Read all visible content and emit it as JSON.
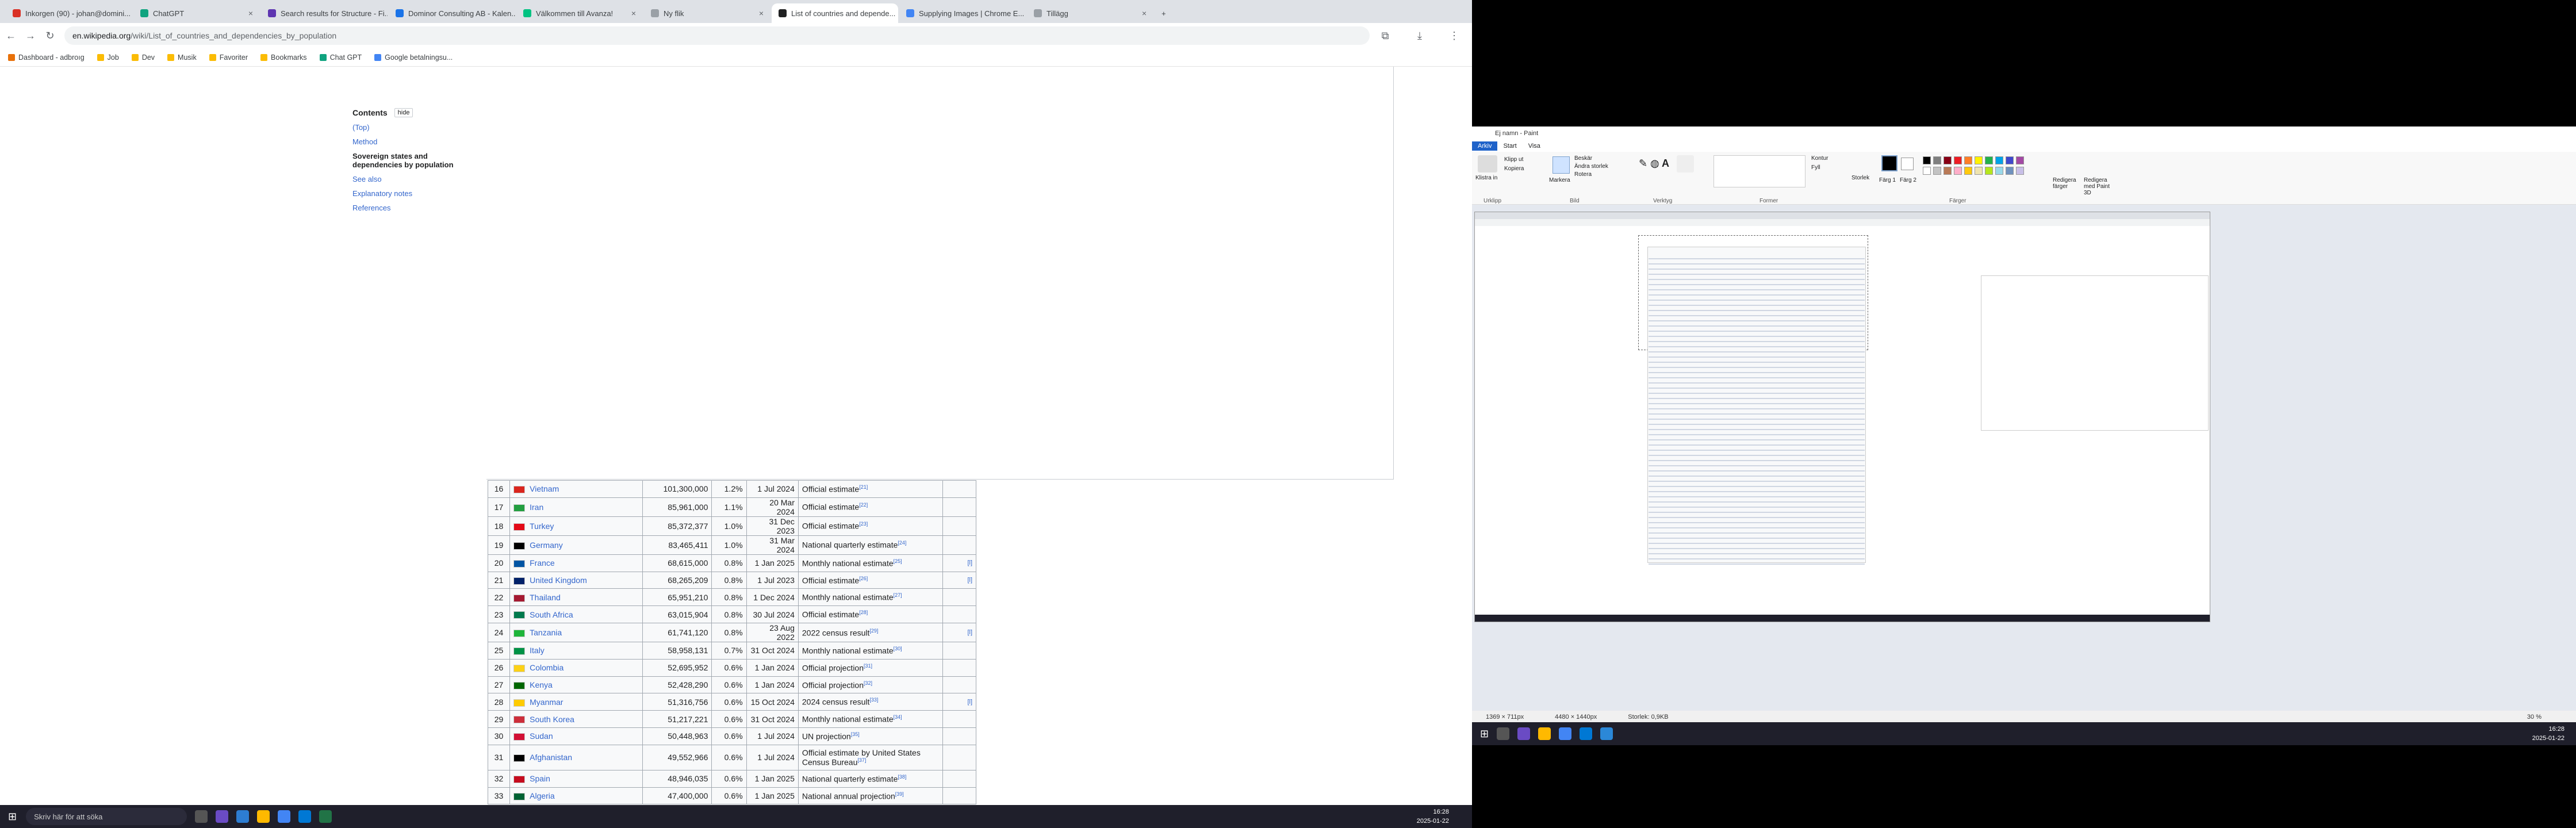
{
  "browser": {
    "tabs": [
      {
        "label": "Inkorgen (90) - johan@domini...",
        "color": "#d93025"
      },
      {
        "label": "ChatGPT",
        "color": "#10a37f"
      },
      {
        "label": "Search results for Structure - Fi...",
        "color": "#5e35b1"
      },
      {
        "label": "Dominor Consulting AB - Kalen...",
        "color": "#1a73e8"
      },
      {
        "label": "Välkommen till Avanza!",
        "color": "#00c281"
      },
      {
        "label": "Ny flik",
        "color": "#9aa0a6"
      },
      {
        "label": "List of countries and depende...",
        "color": "#202122"
      },
      {
        "label": "Supplying Images | Chrome E...",
        "color": "#4285f4"
      },
      {
        "label": "Tillägg",
        "color": "#9aa0a6"
      }
    ],
    "url_host": "en.wikipedia.org",
    "url_path": "/wiki/List_of_countries_and_dependencies_by_population",
    "bookmarks": [
      "Dashboard - adbroıg",
      "Job",
      "Dev",
      "Musik",
      "Favoriter",
      "Bookmarks",
      "Chat GPT",
      "Google betalningsu..."
    ]
  },
  "toc": {
    "title": "Contents",
    "hide_label": "hide",
    "items": [
      "(Top)",
      "Method"
    ],
    "current": "Sovereign states and dependencies by population",
    "items_after": [
      "See also",
      "Explanatory notes",
      "References"
    ]
  },
  "table_rows": [
    {
      "rank": "16",
      "country": "Vietnam",
      "population": "101,300,000",
      "share": "1.2%",
      "date": "1 Jul 2024",
      "source": "Official estimate",
      "ref": "[21]",
      "note": "",
      "flag": "#da251d"
    },
    {
      "rank": "17",
      "country": "Iran",
      "population": "85,961,000",
      "share": "1.1%",
      "date": "20 Mar 2024",
      "source": "Official estimate",
      "ref": "[22]",
      "note": "",
      "flag": "#239f40"
    },
    {
      "rank": "18",
      "country": "Turkey",
      "population": "85,372,377",
      "share": "1.0%",
      "date": "31 Dec 2023",
      "source": "Official estimate",
      "ref": "[23]",
      "note": "",
      "flag": "#e30a17"
    },
    {
      "rank": "19",
      "country": "Germany",
      "population": "83,465,411",
      "share": "1.0%",
      "date": "31 Mar 2024",
      "source": "National quarterly estimate",
      "ref": "[24]",
      "note": "",
      "flag": "#000000"
    },
    {
      "rank": "20",
      "country": "France",
      "population": "68,615,000",
      "share": "0.8%",
      "date": "1 Jan 2025",
      "source": "Monthly national estimate",
      "ref": "[25]",
      "note": "[l]",
      "flag": "#0055a4"
    },
    {
      "rank": "21",
      "country": "United Kingdom",
      "population": "68,265,209",
      "share": "0.8%",
      "date": "1 Jul 2023",
      "source": "Official estimate",
      "ref": "[26]",
      "note": "[l]",
      "flag": "#012169"
    },
    {
      "rank": "22",
      "country": "Thailand",
      "population": "65,951,210",
      "share": "0.8%",
      "date": "1 Dec 2024",
      "source": "Monthly national estimate",
      "ref": "[27]",
      "note": "",
      "flag": "#a51931"
    },
    {
      "rank": "23",
      "country": "South Africa",
      "population": "63,015,904",
      "share": "0.8%",
      "date": "30 Jul 2024",
      "source": "Official estimate",
      "ref": "[28]",
      "note": "",
      "flag": "#007a4d"
    },
    {
      "rank": "24",
      "country": "Tanzania",
      "population": "61,741,120",
      "share": "0.8%",
      "date": "23 Aug 2022",
      "source": "2022 census result",
      "ref": "[29]",
      "note": "[l]",
      "flag": "#1eb53a"
    },
    {
      "rank": "25",
      "country": "Italy",
      "population": "58,958,131",
      "share": "0.7%",
      "date": "31 Oct 2024",
      "source": "Monthly national estimate",
      "ref": "[30]",
      "note": "",
      "flag": "#009246"
    },
    {
      "rank": "26",
      "country": "Colombia",
      "population": "52,695,952",
      "share": "0.6%",
      "date": "1 Jan 2024",
      "source": "Official projection",
      "ref": "[31]",
      "note": "",
      "flag": "#fcd116"
    },
    {
      "rank": "27",
      "country": "Kenya",
      "population": "52,428,290",
      "share": "0.6%",
      "date": "1 Jan 2024",
      "source": "Official projection",
      "ref": "[32]",
      "note": "",
      "flag": "#006600"
    },
    {
      "rank": "28",
      "country": "Myanmar",
      "population": "51,316,756",
      "share": "0.6%",
      "date": "15 Oct 2024",
      "source": "2024 census result",
      "ref": "[33]",
      "note": "[l]",
      "flag": "#fecb00"
    },
    {
      "rank": "29",
      "country": "South Korea",
      "population": "51,217,221",
      "share": "0.6%",
      "date": "31 Oct 2024",
      "source": "Monthly national estimate",
      "ref": "[34]",
      "note": "",
      "flag": "#cd2e3a"
    },
    {
      "rank": "30",
      "country": "Sudan",
      "population": "50,448,963",
      "share": "0.6%",
      "date": "1 Jul 2024",
      "source": "UN projection",
      "ref": "[35]",
      "note": "",
      "flag": "#d21034"
    },
    {
      "rank": "31",
      "country": "Afghanistan",
      "population": "49,552,966",
      "share": "0.6%",
      "date": "1 Jul 2024",
      "source": "Official estimate by United States Census Bureau",
      "ref": "[37]",
      "note": "",
      "flag": "#000000"
    },
    {
      "rank": "32",
      "country": "Spain",
      "population": "48,946,035",
      "share": "0.6%",
      "date": "1 Jan 2025",
      "source": "National quarterly estimate",
      "ref": "[38]",
      "note": "",
      "flag": "#c60b1e"
    },
    {
      "rank": "33",
      "country": "Algeria",
      "population": "47,400,000",
      "share": "0.6%",
      "date": "1 Jan 2025",
      "source": "National annual projection",
      "ref": "[39]",
      "note": "",
      "flag": "#006233"
    }
  ],
  "taskbar_left": {
    "search_placeholder": "Skriv här för att söka",
    "time": "16:28",
    "date": "2025-01-22"
  },
  "paint": {
    "title": "Ej namn - Paint",
    "tabs": [
      "Arkiv",
      "Start",
      "Visa"
    ],
    "groups": [
      "Urklipp",
      "Bild",
      "Verktyg",
      "Former",
      "Färger"
    ],
    "clipboard": [
      "Klistra in",
      "Klipp ut",
      "Kopiera"
    ],
    "image": [
      "Markera",
      "Beskär",
      "Ändra storlek",
      "Rotera"
    ],
    "shapes_opts": [
      "Kontur",
      "Fyll"
    ],
    "size_label": "Storlek",
    "color_labels": [
      "Färg 1",
      "Färg 2"
    ],
    "edit_colors": "Redigera färger",
    "edit_paint3d": "Redigera med Paint 3D",
    "status": {
      "cursor": "1369 × 711px",
      "image_size": "4480 × 1440px",
      "file_size": "Storlek: 0,9KB",
      "zoom": "30 %"
    }
  },
  "taskbar_right": {
    "time": "16:28",
    "date": "2025-01-22"
  },
  "colors": {
    "palette": [
      "#000000",
      "#7f7f7f",
      "#880015",
      "#ed1c24",
      "#ff7f27",
      "#fff200",
      "#22b14c",
      "#00a2e8",
      "#3f48cc",
      "#a349a4",
      "#ffffff",
      "#c3c3c3",
      "#b97a57",
      "#ffaec9",
      "#ffc90e",
      "#efe4b0",
      "#b5e61d",
      "#99d9ea",
      "#7092be",
      "#c8bfe7"
    ]
  }
}
